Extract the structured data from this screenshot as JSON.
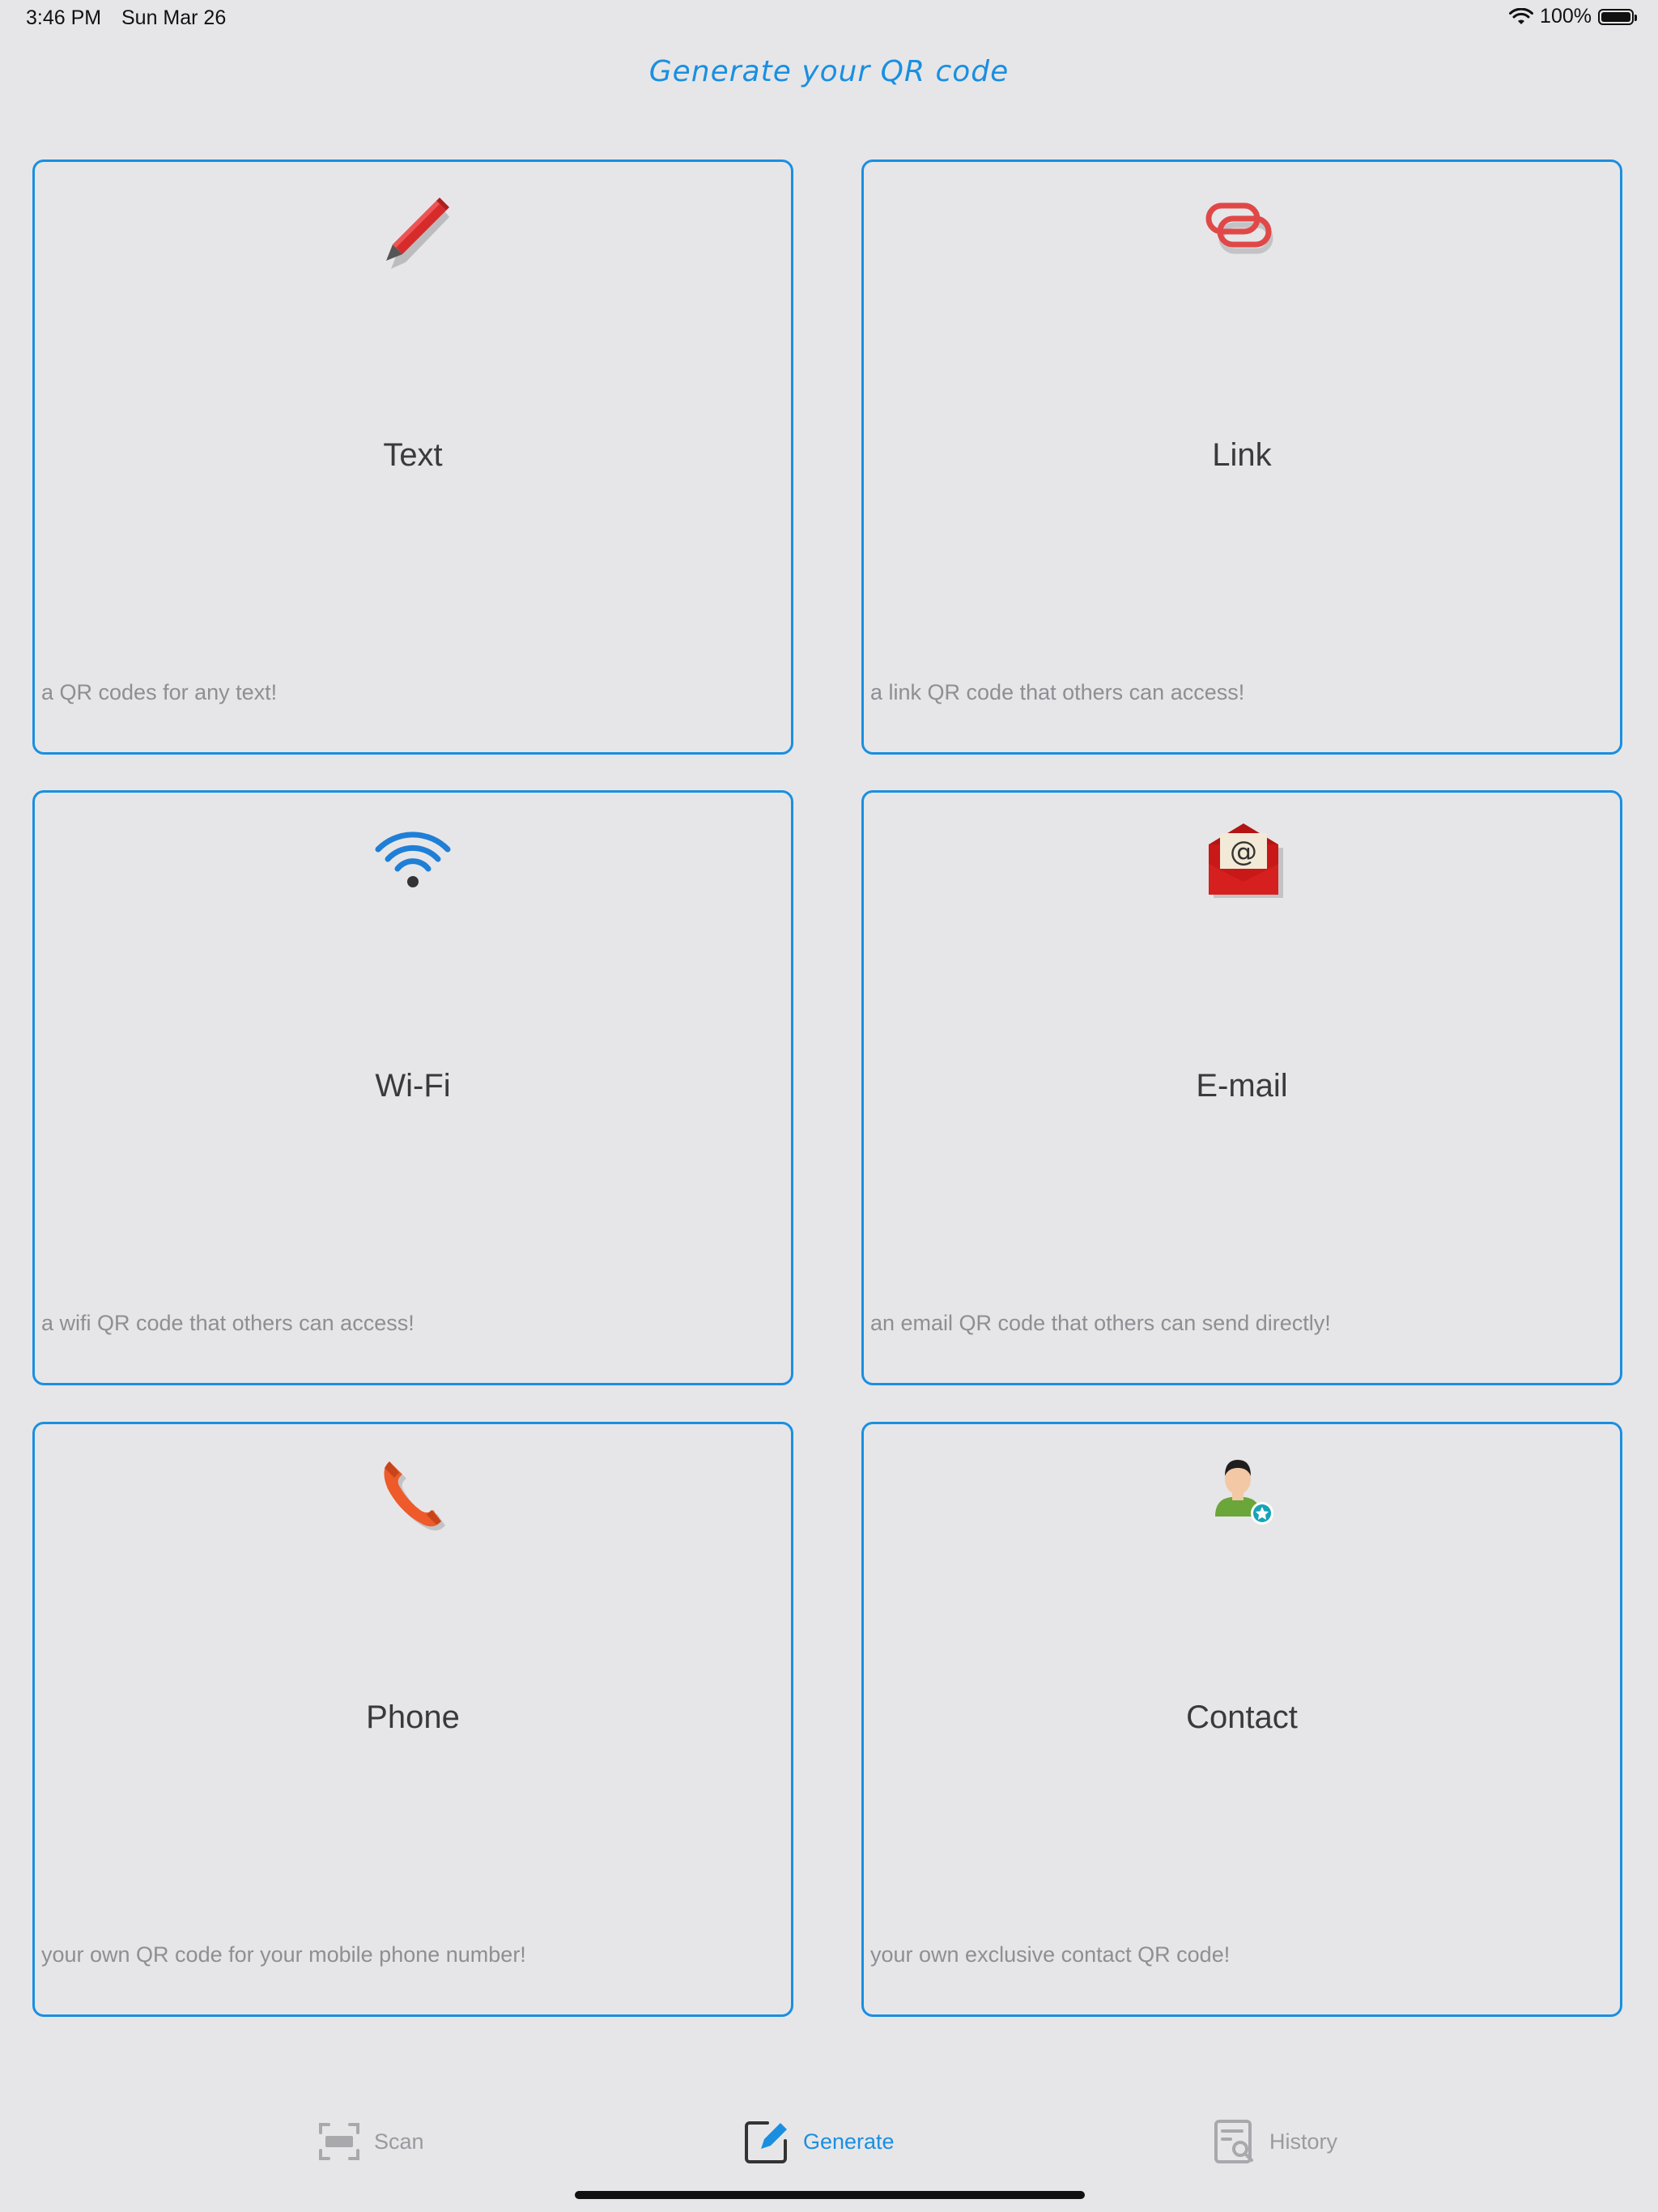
{
  "status_bar": {
    "time": "3:46 PM",
    "date": "Sun Mar 26",
    "battery": "100%"
  },
  "header": {
    "title": "Generate your QR code"
  },
  "cards": [
    {
      "title": "Text",
      "description": "a QR codes for any text!",
      "icon": "pencil-icon"
    },
    {
      "title": "Link",
      "description": "a link QR code that others can access!",
      "icon": "link-icon"
    },
    {
      "title": "Wi-Fi",
      "description": "a wifi QR code that others can access!",
      "icon": "wifi-icon"
    },
    {
      "title": "E-mail",
      "description": "an email QR code that others can send directly!",
      "icon": "email-icon"
    },
    {
      "title": "Phone",
      "description": "your own QR code for your mobile phone number!",
      "icon": "phone-icon"
    },
    {
      "title": "Contact",
      "description": "your own exclusive contact QR code!",
      "icon": "contact-icon"
    }
  ],
  "tabs": [
    {
      "label": "Scan",
      "icon": "scan-icon",
      "active": false
    },
    {
      "label": "Generate",
      "icon": "generate-icon",
      "active": true
    },
    {
      "label": "History",
      "icon": "history-icon",
      "active": false
    }
  ],
  "colors": {
    "accent": "#1a8fe0",
    "background": "#e6e6e9",
    "muted": "#8e8e93"
  }
}
